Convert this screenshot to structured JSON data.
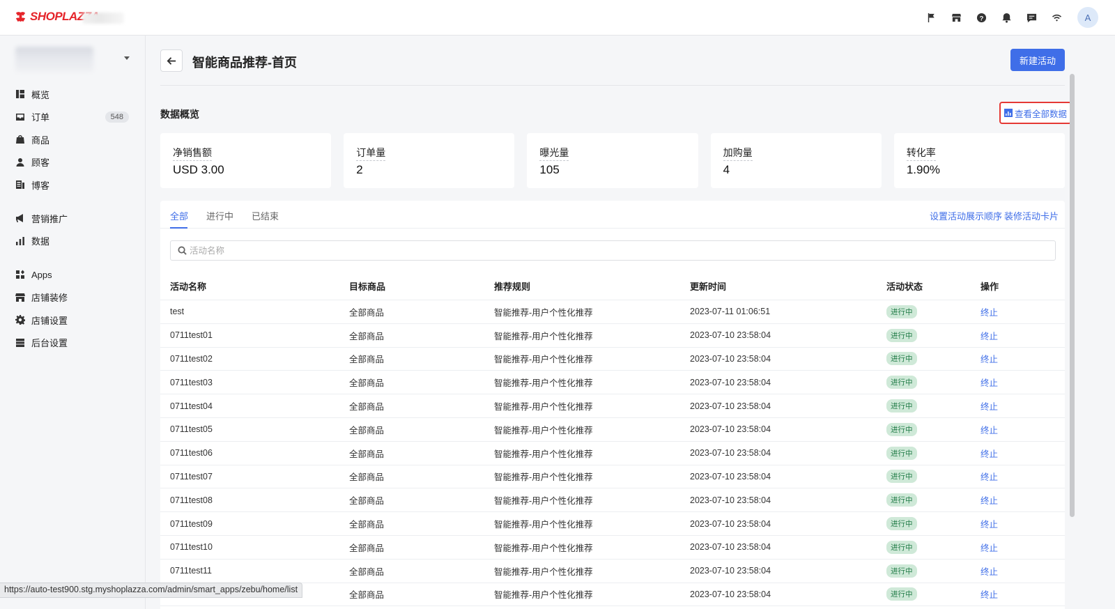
{
  "brand": {
    "logo_text": "SHOPLAZZA",
    "accent": "#e5242a"
  },
  "top_icons": [
    "flag-icon",
    "store-icon",
    "help-icon",
    "bell-icon",
    "message-icon",
    "wifi-icon"
  ],
  "user": {
    "avatar_letter": "A"
  },
  "sidebar": {
    "items": [
      {
        "label": "概览",
        "icon": "overview-icon"
      },
      {
        "label": "订单",
        "icon": "order-icon",
        "badge": "548"
      },
      {
        "label": "商品",
        "icon": "product-icon"
      },
      {
        "label": "顾客",
        "icon": "customer-icon"
      },
      {
        "label": "博客",
        "icon": "blog-icon"
      },
      {
        "label": "营销推广",
        "icon": "megaphone-icon"
      },
      {
        "label": "数据",
        "icon": "chart-icon"
      },
      {
        "label": "Apps",
        "icon": "apps-icon"
      },
      {
        "label": "店铺装修",
        "icon": "store-design-icon"
      },
      {
        "label": "店铺设置",
        "icon": "settings-icon"
      },
      {
        "label": "后台设置",
        "icon": "backend-icon"
      }
    ]
  },
  "header": {
    "title": "智能商品推荐-首页",
    "new_button": "新建活动"
  },
  "overview": {
    "title": "数据概览",
    "view_all": "查看全部数据",
    "stats": [
      {
        "label": "净销售额",
        "value": "USD 3.00"
      },
      {
        "label": "订单量",
        "value": "2"
      },
      {
        "label": "曝光量",
        "value": "105"
      },
      {
        "label": "加购量",
        "value": "4"
      },
      {
        "label": "转化率",
        "value": "1.90%"
      }
    ]
  },
  "tabs": [
    {
      "label": "全部"
    },
    {
      "label": "进行中"
    },
    {
      "label": "已结束"
    }
  ],
  "tab_links": {
    "order": "设置活动展示顺序",
    "card": "装修活动卡片"
  },
  "search": {
    "placeholder": "活动名称"
  },
  "table": {
    "columns": [
      "活动名称",
      "目标商品",
      "推荐规则",
      "更新时间",
      "活动状态",
      "操作"
    ],
    "rows": [
      {
        "name": "test",
        "target": "全部商品",
        "rule": "智能推荐-用户个性化推荐",
        "time": "2023-07-11 01:06:51",
        "status": "进行中",
        "action": "终止"
      },
      {
        "name": "0711test01",
        "target": "全部商品",
        "rule": "智能推荐-用户个性化推荐",
        "time": "2023-07-10 23:58:04",
        "status": "进行中",
        "action": "终止"
      },
      {
        "name": "0711test02",
        "target": "全部商品",
        "rule": "智能推荐-用户个性化推荐",
        "time": "2023-07-10 23:58:04",
        "status": "进行中",
        "action": "终止"
      },
      {
        "name": "0711test03",
        "target": "全部商品",
        "rule": "智能推荐-用户个性化推荐",
        "time": "2023-07-10 23:58:04",
        "status": "进行中",
        "action": "终止"
      },
      {
        "name": "0711test04",
        "target": "全部商品",
        "rule": "智能推荐-用户个性化推荐",
        "time": "2023-07-10 23:58:04",
        "status": "进行中",
        "action": "终止"
      },
      {
        "name": "0711test05",
        "target": "全部商品",
        "rule": "智能推荐-用户个性化推荐",
        "time": "2023-07-10 23:58:04",
        "status": "进行中",
        "action": "终止"
      },
      {
        "name": "0711test06",
        "target": "全部商品",
        "rule": "智能推荐-用户个性化推荐",
        "time": "2023-07-10 23:58:04",
        "status": "进行中",
        "action": "终止"
      },
      {
        "name": "0711test07",
        "target": "全部商品",
        "rule": "智能推荐-用户个性化推荐",
        "time": "2023-07-10 23:58:04",
        "status": "进行中",
        "action": "终止"
      },
      {
        "name": "0711test08",
        "target": "全部商品",
        "rule": "智能推荐-用户个性化推荐",
        "time": "2023-07-10 23:58:04",
        "status": "进行中",
        "action": "终止"
      },
      {
        "name": "0711test09",
        "target": "全部商品",
        "rule": "智能推荐-用户个性化推荐",
        "time": "2023-07-10 23:58:04",
        "status": "进行中",
        "action": "终止"
      },
      {
        "name": "0711test10",
        "target": "全部商品",
        "rule": "智能推荐-用户个性化推荐",
        "time": "2023-07-10 23:58:04",
        "status": "进行中",
        "action": "终止"
      },
      {
        "name": "0711test11",
        "target": "全部商品",
        "rule": "智能推荐-用户个性化推荐",
        "time": "2023-07-10 23:58:04",
        "status": "进行中",
        "action": "终止"
      },
      {
        "name": "",
        "target": "全部商品",
        "rule": "智能推荐-用户个性化推荐",
        "time": "2023-07-10 23:58:04",
        "status": "进行中",
        "action": "终止"
      }
    ]
  },
  "status_bar": {
    "url": "https://auto-test900.stg.myshoplazza.com/admin/smart_apps/zebu/home/list"
  }
}
